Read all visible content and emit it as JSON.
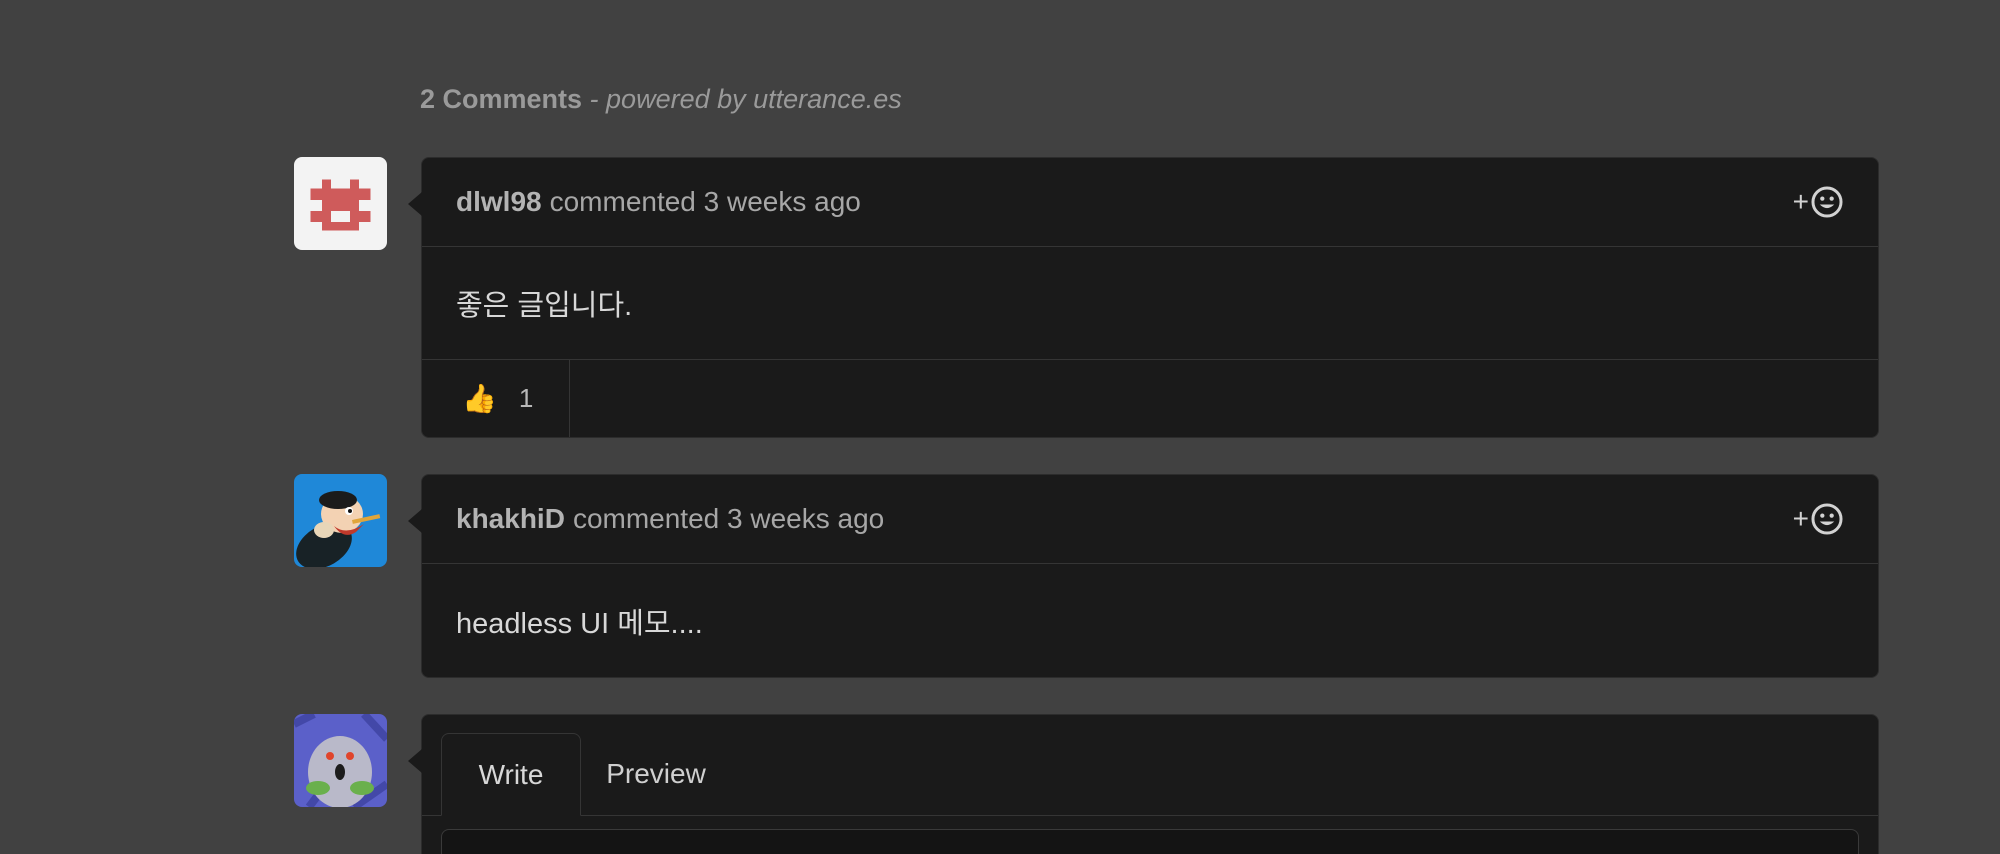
{
  "header": {
    "count_label": "2 Comments",
    "powered_label": " - powered by utterance.es"
  },
  "comments": [
    {
      "author": "dlwl98",
      "meta": "commented 3 weeks ago",
      "body": "좋은 글입니다.",
      "reaction": {
        "emoji": "👍",
        "count": "1"
      }
    },
    {
      "author": "khakhiD",
      "meta": "commented 3 weeks ago",
      "body": "headless UI 메모...."
    }
  ],
  "editor": {
    "tab_write": "Write",
    "tab_preview": "Preview"
  },
  "react_button_plus": "+",
  "icons": {
    "add_reaction": "smiley-icon",
    "reaction": "thumbs-up-icon"
  },
  "colors": {
    "background": "#414141",
    "card": "#1a1a1a",
    "border": "#353535",
    "identicon": "#cf5b5b",
    "thumb": "#f2b53a"
  }
}
